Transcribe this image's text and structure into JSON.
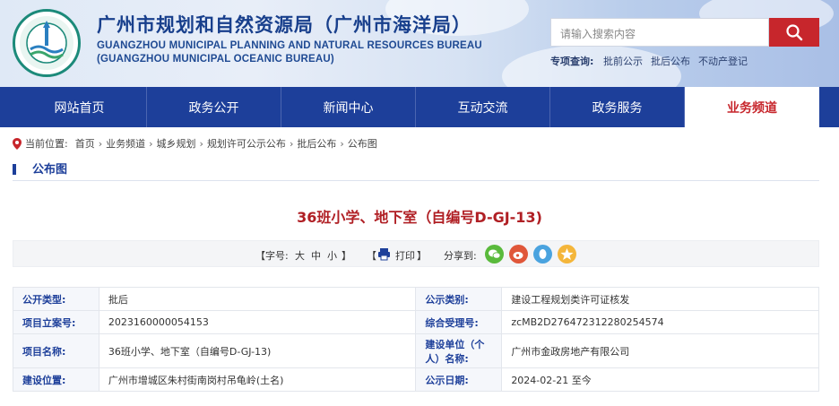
{
  "header": {
    "title": "广州市规划和自然资源局（广州市海洋局）",
    "en_line1": "GUANGZHOU MUNICIPAL PLANNING AND NATURAL RESOURCES BUREAU",
    "en_line2": "(GUANGZHOU MUNICIPAL OCEANIC BUREAU)",
    "search_placeholder": "请输入搜索内容",
    "quick_label": "专项查询:",
    "quick_links": [
      "批前公示",
      "批后公布",
      "不动产登记"
    ]
  },
  "nav": {
    "items": [
      "网站首页",
      "政务公开",
      "新闻中心",
      "互动交流",
      "政务服务",
      "业务频道"
    ],
    "active_index": 5
  },
  "breadcrumb": {
    "label": "当前位置:",
    "items": [
      "首页",
      "业务频道",
      "城乡规划",
      "规划许可公示公布",
      "批后公布",
      "公布图"
    ],
    "separator": "›"
  },
  "section": {
    "title": "公布图"
  },
  "article": {
    "title": "36班小学、地下室（自编号D-GJ-13)"
  },
  "toolbar": {
    "font_label": "【字号:",
    "sizes": [
      "大",
      "中",
      "小"
    ],
    "font_close": "】",
    "print_open": "【",
    "print_label": "打印",
    "print_close": "】",
    "share_label": "分享到:",
    "share_icons": [
      "wechat-icon",
      "weibo-icon",
      "qq-icon",
      "qzone-icon"
    ],
    "colors": {
      "wechat": "#5aba3c",
      "weibo": "#e0573a",
      "qq": "#4aa3df",
      "qzone": "#f4b63b"
    }
  },
  "info": {
    "rows": [
      {
        "l1": "公开类型:",
        "v1": "批后",
        "l2": "公示类别:",
        "v2": "建设工程规划类许可证核发"
      },
      {
        "l1": "项目立案号:",
        "v1": "2023160000054153",
        "l2": "综合受理号:",
        "v2": "zcMB2D276472312280254574"
      },
      {
        "l1": "项目名称:",
        "v1": "36班小学、地下室（自编号D-GJ-13)",
        "l2": "建设单位（个人）名称:",
        "v2": "广州市金政房地产有限公司"
      },
      {
        "l1": "建设位置:",
        "v1": "广州市增城区朱村街南岗村吊龟岭(土名)",
        "l2": "公示日期:",
        "v2": "2024-02-21 至今"
      }
    ]
  },
  "colors": {
    "nav_bg": "#1d3f9a",
    "accent_red": "#c7262c",
    "title_red": "#b01f24"
  }
}
